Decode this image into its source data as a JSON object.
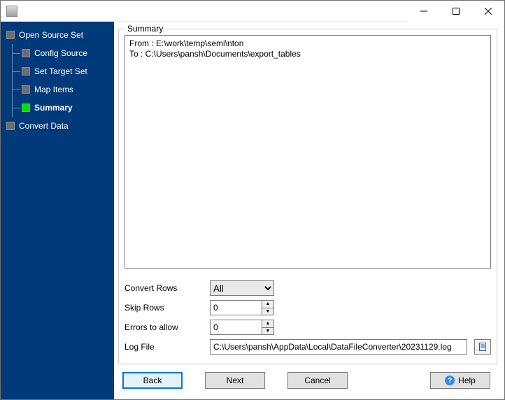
{
  "window": {
    "title": ""
  },
  "sidebar": {
    "items": [
      {
        "label": "Open Source Set",
        "root": true
      },
      {
        "label": "Config Source"
      },
      {
        "label": "Set Target Set"
      },
      {
        "label": "Map Items"
      },
      {
        "label": "Summary",
        "active": true
      },
      {
        "label": "Convert Data",
        "root": true
      }
    ]
  },
  "summary": {
    "title": "Summary",
    "from_line": "From : E:\\work\\temp\\semi\\nton",
    "to_line": "To : C:\\Users\\pansh\\Documents\\export_tables"
  },
  "form": {
    "convert_rows": {
      "label": "Convert Rows",
      "value": "All",
      "options": [
        "All"
      ]
    },
    "skip_rows": {
      "label": "Skip Rows",
      "value": "0"
    },
    "errors_allow": {
      "label": "Errors to allow",
      "value": "0"
    },
    "log_file": {
      "label": "Log File",
      "value": "C:\\Users\\pansh\\AppData\\Local\\DataFileConverter\\20231129.log"
    }
  },
  "buttons": {
    "back": "Back",
    "next": "Next",
    "cancel": "Cancel",
    "help": "Help"
  }
}
